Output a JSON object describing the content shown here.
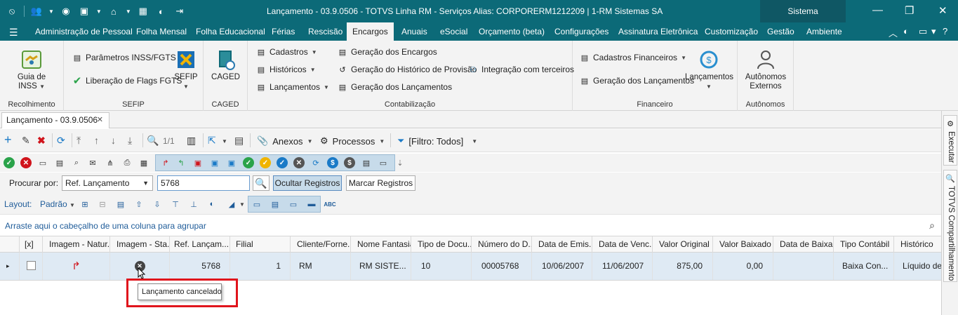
{
  "window": {
    "title": "Lançamento - 03.9.0506 - TOTVS Linha RM - Serviços  Alias: CORPORERM1212209 | 1-RM Sistemas SA",
    "sistema_label": "Sistema",
    "minimize_glyph": "—",
    "restore_glyph": "❐",
    "close_glyph": "✕"
  },
  "menu": {
    "items": [
      "Administração de Pessoal",
      "Folha Mensal",
      "Folha Educacional",
      "Férias",
      "Rescisão",
      "Encargos",
      "Anuais",
      "eSocial",
      "Orçamento (beta)",
      "Configurações",
      "Assinatura Eletrônica",
      "Customização",
      "Gestão",
      "Ambiente"
    ],
    "active": "Encargos"
  },
  "ribbon": {
    "recolhimento": {
      "group_label": "Recolhimento",
      "guia_inss_line1": "Guia de",
      "guia_inss_line2": "INSS"
    },
    "sefip": {
      "group_label": "SEFIP",
      "parametros": "Parâmetros INSS/FGTS",
      "liberacao": "Liberação de Flags FGTS",
      "sefip_btn": "SEFIP"
    },
    "caged": {
      "group_label": "CAGED",
      "caged_btn": "CAGED"
    },
    "contabilizacao": {
      "group_label": "Contabilização",
      "cadastros": "Cadastros",
      "historicos": "Históricos",
      "lancamentos": "Lançamentos",
      "geracao_encargos": "Geração dos Encargos",
      "geracao_historico": "Geração do Histórico de Provisão",
      "geracao_lancamentos": "Geração dos Lançamentos",
      "integracao": "Integração com terceiros"
    },
    "financeiro": {
      "group_label": "Financeiro",
      "cadastros_fin": "Cadastros Financeiros",
      "geracao_lanc": "Geração dos Lançamentos",
      "lancamentos_btn": "Lançamentos"
    },
    "autonomos": {
      "group_label": "Autônomos",
      "autonomos_line1": "Autônomos",
      "autonomos_line2": "Externos"
    }
  },
  "doc_tab": {
    "label": "Lançamento - 03.9.0506",
    "close": "✕"
  },
  "side_panel": {
    "executar": "Executar",
    "totvs": "TOTVS Compartilhamento"
  },
  "toolbar": {
    "page_indicator": "1/1",
    "anexos": "Anexos",
    "processos": "Processos",
    "filtro": "[Filtro: Todos]"
  },
  "search": {
    "procurar_label": "Procurar por:",
    "field_value": "Ref. Lançamento",
    "search_value": "5768",
    "ocultar_btn": "Ocultar Registros",
    "marcar_btn": "Marcar Registros"
  },
  "layout": {
    "label": "Layout:",
    "value": "Padrão"
  },
  "grouping_hint": "Arraste aqui o cabeçalho de uma coluna para agrupar",
  "grid": {
    "columns": [
      "[x]",
      "Imagem - Natur...",
      "Imagem - Sta...",
      "Ref. Lançam...",
      "Filial",
      "Cliente/Forne...",
      "Nome Fantasia",
      "Tipo de Docu...",
      "Número do D...",
      "Data de Emis...",
      "Data de Venc...",
      "Valor Original",
      "Valor Baixado",
      "Data de Baixa",
      "Tipo Contábil",
      "Histórico"
    ],
    "row": {
      "ref": "5768",
      "filial": "1",
      "cliente": "RM",
      "nome_fantasia": "RM SISTE...",
      "tipo_doc": "10",
      "numero_doc": "00005768",
      "data_emissao": "10/06/2007",
      "data_vencimento": "11/06/2007",
      "valor_original": "875,00",
      "valor_baixado": "0,00",
      "data_baixa": "",
      "tipo_contabil": "Baixa Con...",
      "historico": "Líquido de..."
    }
  },
  "tooltip": "Lançamento cancelado",
  "colors": {
    "titlebar": "#0c6a78",
    "accent_highlight": "#e0141c",
    "selected_row": "#dfeaf4"
  }
}
